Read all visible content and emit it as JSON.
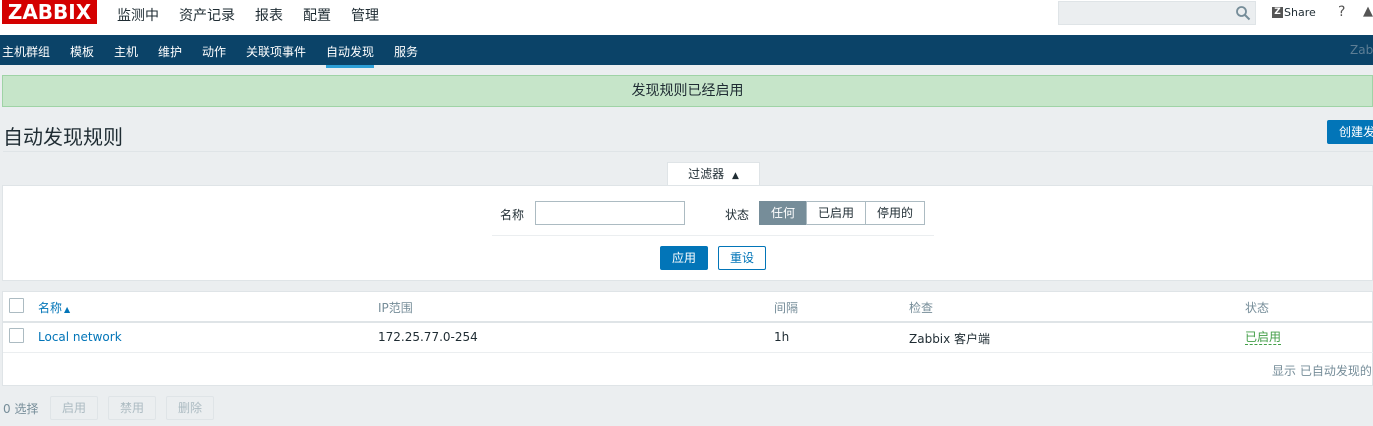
{
  "brand": {
    "logo_text": "ZABBIX",
    "logo_color": "#d40000"
  },
  "top_menu": [
    {
      "label": "监测中"
    },
    {
      "label": "资产记录"
    },
    {
      "label": "报表"
    },
    {
      "label": "配置",
      "active": true
    },
    {
      "label": "管理"
    }
  ],
  "top_right": {
    "search_placeholder": "",
    "share_label": "Share",
    "share_mark": "Z",
    "help_label": "?"
  },
  "sub_menu": [
    {
      "label": "主机群组"
    },
    {
      "label": "模板"
    },
    {
      "label": "主机"
    },
    {
      "label": "维护"
    },
    {
      "label": "动作"
    },
    {
      "label": "关联项事件"
    },
    {
      "label": "自动发现",
      "selected": true
    },
    {
      "label": "服务"
    }
  ],
  "sub_menu_brand": "Zabb",
  "message": "发现规则已经启用",
  "page": {
    "title": "自动发现规则",
    "create_button": "创建发"
  },
  "filter": {
    "tab_label": "过滤器",
    "name_label": "名称",
    "name_value": "",
    "status_label": "状态",
    "status_options": [
      "任何",
      "已启用",
      "停用的"
    ],
    "status_selected": "任何",
    "apply_label": "应用",
    "reset_label": "重设"
  },
  "table": {
    "columns": [
      "名称",
      "IP范围",
      "间隔",
      "检查",
      "状态"
    ],
    "sort_column": "名称",
    "rows": [
      {
        "name": "Local network",
        "ip_range": "172.25.77.0-254",
        "interval": "1h",
        "checks": "Zabbix 客户端",
        "status": "已启用"
      }
    ],
    "footer": "显示 已自动发现的"
  },
  "actions": {
    "selected_count": "0 选择",
    "buttons": [
      "启用",
      "禁用",
      "删除"
    ]
  },
  "colors": {
    "nav_bg": "#0b4368",
    "accent": "#0275b8",
    "success_bg": "#c6e5c9",
    "enabled_text": "#429e47"
  }
}
